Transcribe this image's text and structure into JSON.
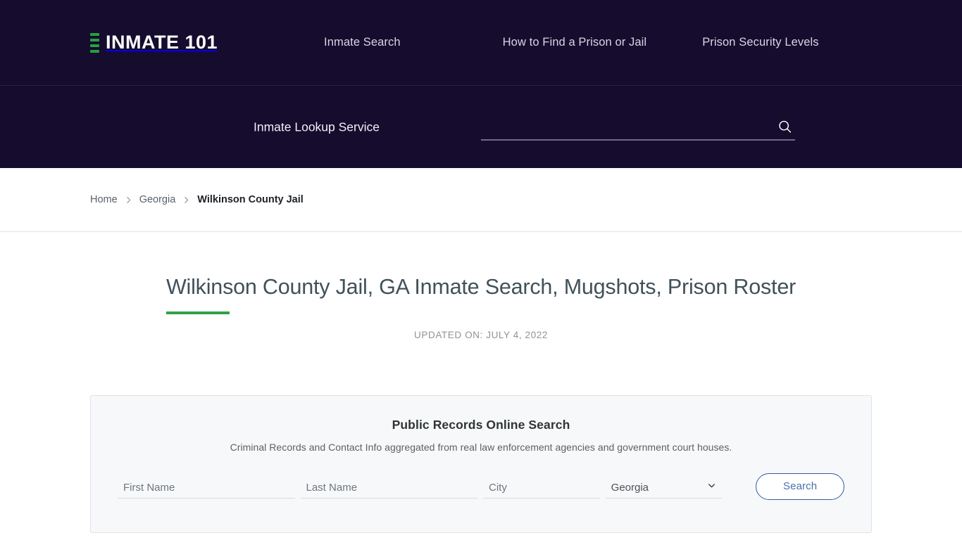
{
  "brand": {
    "name": "INMATE 101",
    "mark_color": "#27a03f",
    "bar_count": 4
  },
  "nav": {
    "items": [
      {
        "label": "Inmate Search"
      },
      {
        "label": "How to Find a Prison or Jail"
      },
      {
        "label": "Prison Security Levels"
      }
    ]
  },
  "search_strip": {
    "label": "Inmate Lookup Service",
    "input_value": "",
    "input_placeholder": "",
    "icon": "search-icon"
  },
  "breadcrumb": {
    "items": [
      {
        "label": "Home",
        "current": false
      },
      {
        "label": "Georgia",
        "current": false
      },
      {
        "label": "Wilkinson County Jail",
        "current": true
      }
    ],
    "separator": "chevron-right-icon"
  },
  "main": {
    "title": "Wilkinson County Jail, GA Inmate Search, Mugshots, Prison Roster",
    "title_accent_color": "#31a24c",
    "updated": "UPDATED ON: JULY 4, 2022"
  },
  "records_card": {
    "title": "Public Records Online Search",
    "subtitle": "Criminal Records and Contact Info aggregated from real law enforcement agencies and government court houses.",
    "fields": {
      "first_name_placeholder": "First Name",
      "first_name_value": "",
      "last_name_placeholder": "Last Name",
      "last_name_value": "",
      "city_placeholder": "City",
      "city_value": "",
      "state_selected": "Georgia",
      "state_options": [
        "Georgia"
      ]
    },
    "submit_label": "Search",
    "submit_color": "#2f5da3"
  },
  "theme": {
    "header_bg": "#150c2e",
    "page_bg": "#ffffff",
    "card_bg": "#f7f8fa",
    "accent_green": "#31a24c"
  }
}
